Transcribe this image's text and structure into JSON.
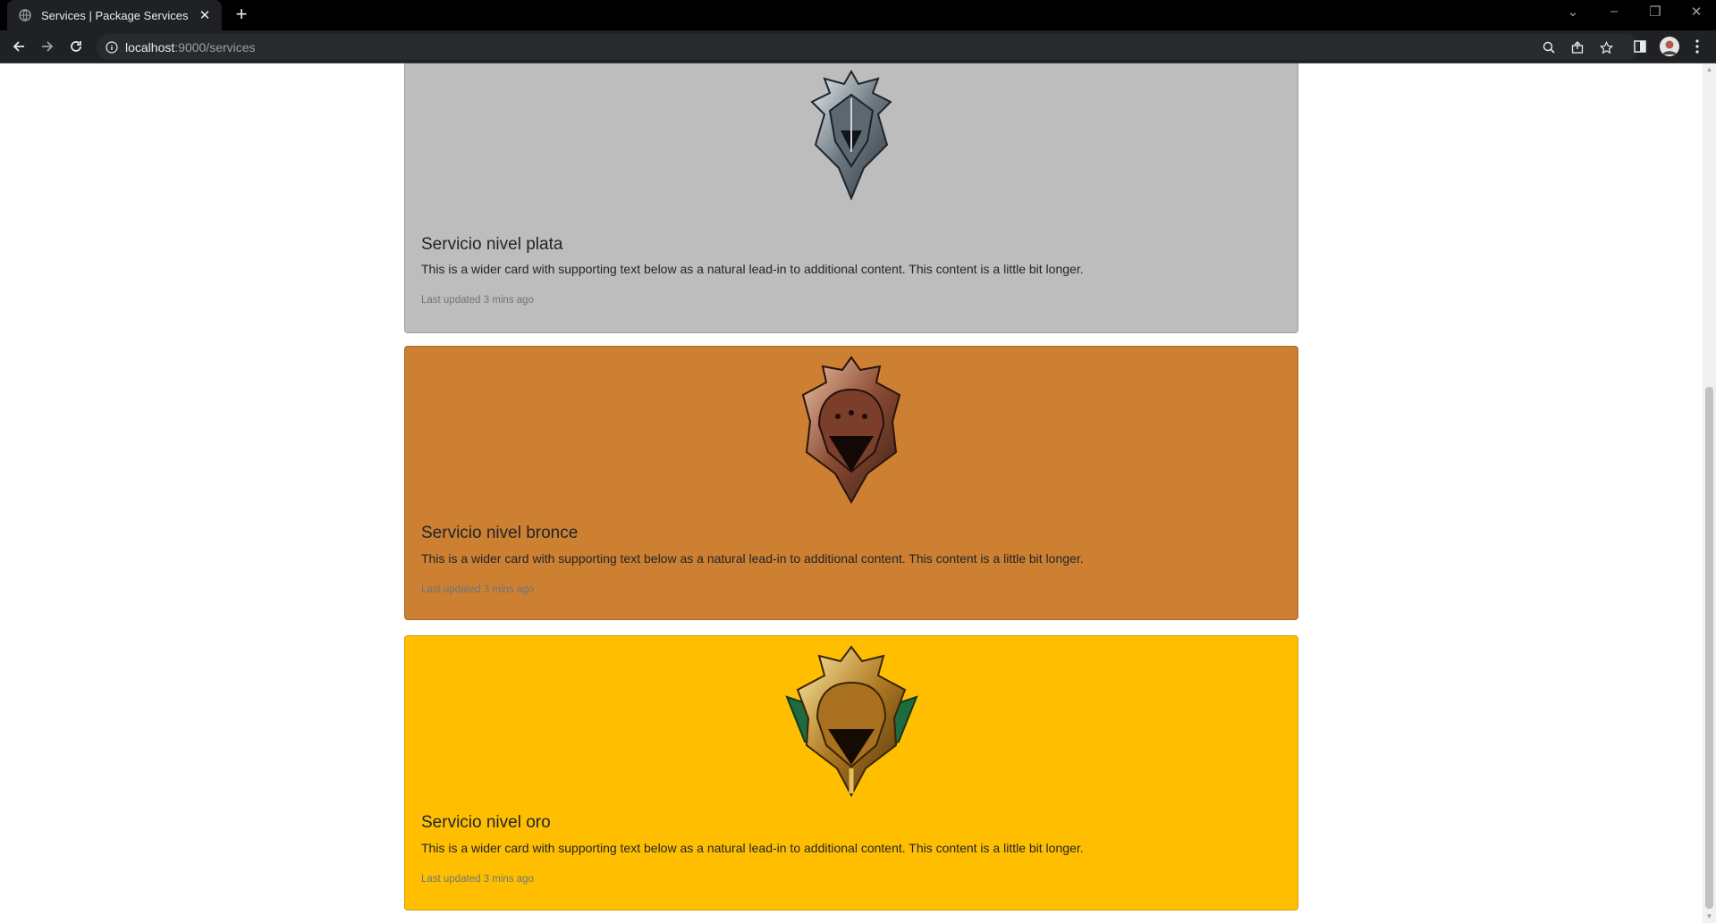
{
  "browser": {
    "tab_title": "Services | Package Services",
    "url_host": "localhost",
    "url_path": ":9000/services"
  },
  "theme": {
    "silver": "#bdbdbd",
    "bronze": "#cd7f32",
    "gold": "#ffbf00"
  },
  "cards": [
    {
      "title": "Servicio nivel plata",
      "text": "This is a wider card with supporting text below as a natural lead-in to additional content. This content is a little bit longer.",
      "updated": "Last updated 3 mins ago",
      "emblem": "silver-emblem-icon"
    },
    {
      "title": "Servicio nivel bronce",
      "text": "This is a wider card with supporting text below as a natural lead-in to additional content. This content is a little bit longer.",
      "updated": "Last updated 3 mins ago",
      "emblem": "bronze-emblem-icon"
    },
    {
      "title": "Servicio nivel oro",
      "text": "This is a wider card with supporting text below as a natural lead-in to additional content. This content is a little bit longer.",
      "updated": "Last updated 3 mins ago",
      "emblem": "gold-emblem-icon"
    }
  ]
}
